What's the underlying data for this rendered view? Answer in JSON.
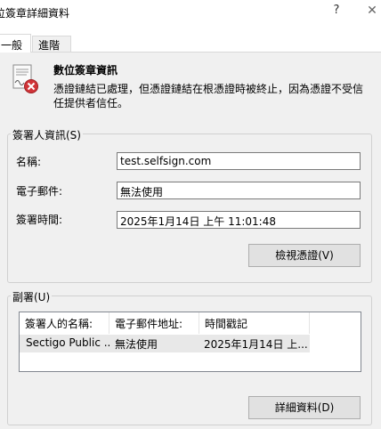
{
  "window": {
    "title": "位簽章詳細資料",
    "help_glyph": "?",
    "close_glyph": "✕"
  },
  "tabs": [
    {
      "label": "一般",
      "active": true
    },
    {
      "label": "進階",
      "active": false
    }
  ],
  "info": {
    "heading": "數位簽章資訊",
    "message": "憑證鏈結已處理，但憑證鏈結在根憑證時被終止，因為憑證不受信任提供者信任。"
  },
  "signer": {
    "group_label": "簽署人資訊(S)",
    "name_label": "名稱:",
    "name_value": "test.selfsign.com",
    "email_label": "電子郵件:",
    "email_value": "無法使用",
    "time_label": "簽署時間:",
    "time_value": "2025年1月14日 上午 11:01:48",
    "view_cert_button": "檢視憑證(V)"
  },
  "countersign": {
    "group_label": "副署(U)",
    "columns": [
      "簽署人的名稱:",
      "電子郵件地址:",
      "時間戳記"
    ],
    "rows": [
      [
        "Sectigo Public ...",
        "無法使用",
        "2025年1月14日 上..."
      ]
    ],
    "details_button": "詳細資料(D)"
  },
  "colors": {
    "page_bg": "#f0f0f0",
    "selected_row": "#e8e8e8",
    "icon_error": "#d13438"
  }
}
